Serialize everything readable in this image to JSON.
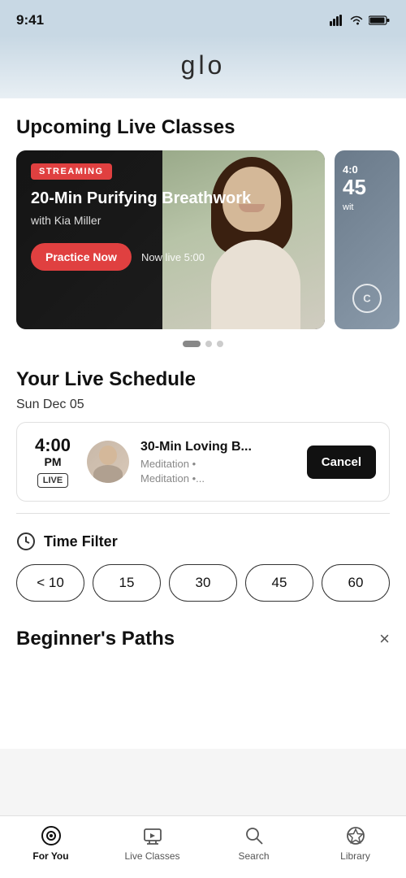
{
  "status_bar": {
    "time": "9:41"
  },
  "header": {
    "logo": "glo"
  },
  "upcoming_section": {
    "title": "Upcoming Live Classes"
  },
  "featured_class": {
    "badge": "STREAMING",
    "title": "20-Min Purifying Breathwork",
    "instructor": "with Kia Miller",
    "cta_label": "Practice Now",
    "live_time": "Now live 5:00"
  },
  "peek_card": {
    "time_prefix": "4:0",
    "duration": "45",
    "instructor_abbr": "wit",
    "circle_label": "C"
  },
  "carousel_dots": [
    {
      "active": true
    },
    {
      "active": false
    },
    {
      "active": false
    }
  ],
  "schedule_section": {
    "title": "Your Live Schedule",
    "date": "Sun Dec 05",
    "schedule_items": [
      {
        "time": "4:00",
        "period": "PM",
        "live_badge": "LIVE",
        "class_name": "30-Min Loving B...",
        "meta_line1": "Meditation •",
        "meta_line2": "Meditation •...",
        "cancel_label": "Cancel"
      }
    ]
  },
  "time_filter": {
    "title": "Time Filter",
    "options": [
      "< 10",
      "15",
      "30",
      "45",
      "60"
    ]
  },
  "beginners": {
    "title": "Beginner's Paths",
    "close_label": "×"
  },
  "bottom_nav": {
    "items": [
      {
        "label": "For You",
        "icon": "for-you",
        "active": true
      },
      {
        "label": "Live Classes",
        "icon": "live-classes",
        "active": false
      },
      {
        "label": "Search",
        "icon": "search",
        "active": false
      },
      {
        "label": "Library",
        "icon": "library",
        "active": false
      }
    ]
  }
}
